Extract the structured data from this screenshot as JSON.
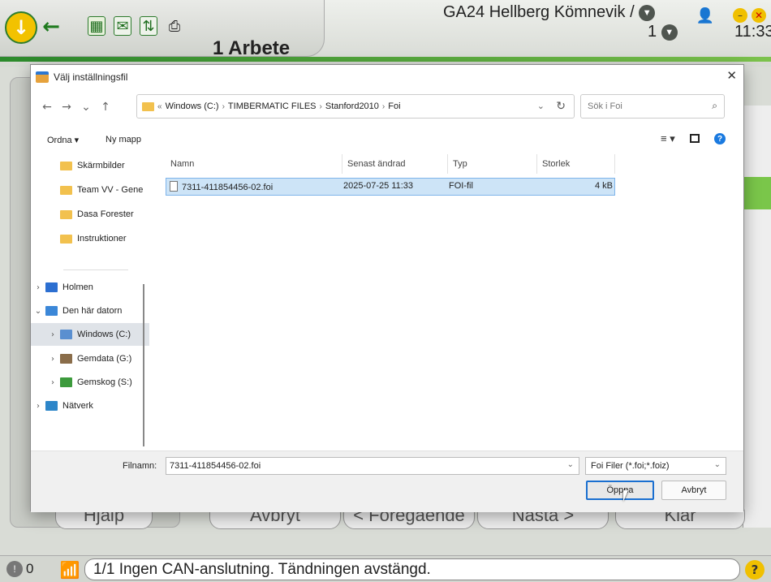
{
  "app": {
    "title": "1 Arbete",
    "operator": "GA24 Hellberg Kömnevik /",
    "number": "1",
    "time": "11:33",
    "status_count": "0",
    "status_message": "1/1 Ingen CAN-anslutning. Tändningen avstängd.",
    "help_glyph": "?",
    "bg_buttons": [
      "Hjälp",
      "Avbryt",
      "< Föregående",
      "Nästa >",
      "Klar"
    ]
  },
  "dialog": {
    "title": "Välj inställningsfil",
    "address": {
      "prefix": "«",
      "crumbs": [
        "Windows (C:)",
        "TIMBERMATIC FILES",
        "Stanford2010",
        "Foi"
      ]
    },
    "search_placeholder": "Sök i Foi",
    "toolbar": {
      "organize": "Ordna ▾",
      "new_folder": "Ny mapp"
    },
    "nav": {
      "quick": [
        "Skärmbilder",
        "Team VV - Gene",
        "Dasa Forester",
        "Instruktioner"
      ],
      "holmen": "Holmen",
      "this_pc": "Den här datorn",
      "windows": "Windows (C:)",
      "gemdata": "Gemdata (G:)",
      "gemskog": "Gemskog (S:)",
      "network": "Nätverk"
    },
    "columns": {
      "name": "Namn",
      "modified": "Senast ändrad",
      "type": "Typ",
      "size": "Storlek"
    },
    "files": [
      {
        "name": "7311-411854456-02.foi",
        "modified": "2025-07-25 11:33",
        "type": "FOI-fil",
        "size": "4 kB"
      }
    ],
    "filename_label": "Filnamn:",
    "filename_value": "7311-411854456-02.foi",
    "filetype": "Foi Filer (*.foi;*.foiz)",
    "open_label": "Öppna",
    "cancel_label": "Avbryt"
  },
  "colors": {
    "accent_green": "#2c8a2c",
    "selection": "#cde4f7",
    "focus": "#1a6fd0"
  }
}
